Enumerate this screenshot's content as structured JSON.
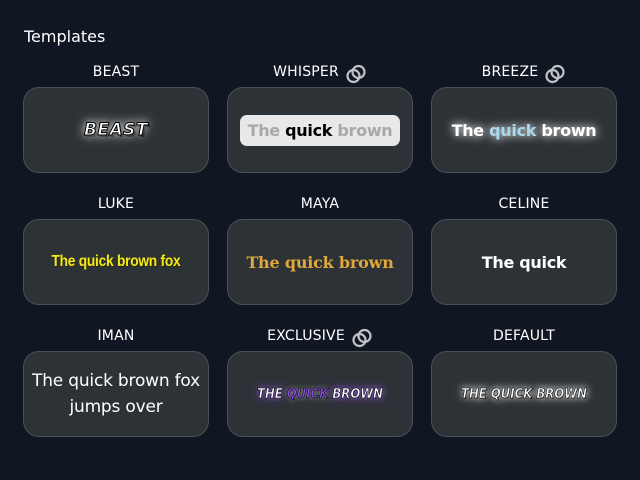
{
  "section": {
    "title": "Templates"
  },
  "colors": {
    "background": "#101722",
    "card_bg": "#2d3236",
    "card_border": "#4a5054",
    "luke_yellow": "#f4e81c",
    "maya_orange": "#e0a73a",
    "breeze_blue": "#a9d9ee",
    "exclusive_purple": "#8c4ce6",
    "whisper_dim": "#a8a8a8"
  },
  "templates": [
    {
      "label": "BEAST",
      "premium": false,
      "preview": "BEAST"
    },
    {
      "label": "WHISPER",
      "premium": true,
      "icon": "linked-rings-icon",
      "preview_dim_1": "The",
      "preview_main": "quick",
      "preview_dim_2": "brown"
    },
    {
      "label": "BREEZE",
      "premium": true,
      "icon": "linked-rings-icon",
      "preview_1": "The",
      "preview_accent": "quick",
      "preview_2": "brown"
    },
    {
      "label": "LUKE",
      "premium": false,
      "preview": "The quick brown fox"
    },
    {
      "label": "MAYA",
      "premium": false,
      "preview": "The quick brown"
    },
    {
      "label": "CELINE",
      "premium": false,
      "preview": "The quick"
    },
    {
      "label": "IMAN",
      "premium": false,
      "preview_line1": "The quick brown fox",
      "preview_line2": "jumps over"
    },
    {
      "label": "EXCLUSIVE",
      "premium": true,
      "icon": "linked-rings-icon",
      "preview_1": "THE",
      "preview_accent": "QUICK",
      "preview_2": "BROWN"
    },
    {
      "label": "DEFAULT",
      "premium": false,
      "preview": "THE QUICK BROWN"
    }
  ]
}
